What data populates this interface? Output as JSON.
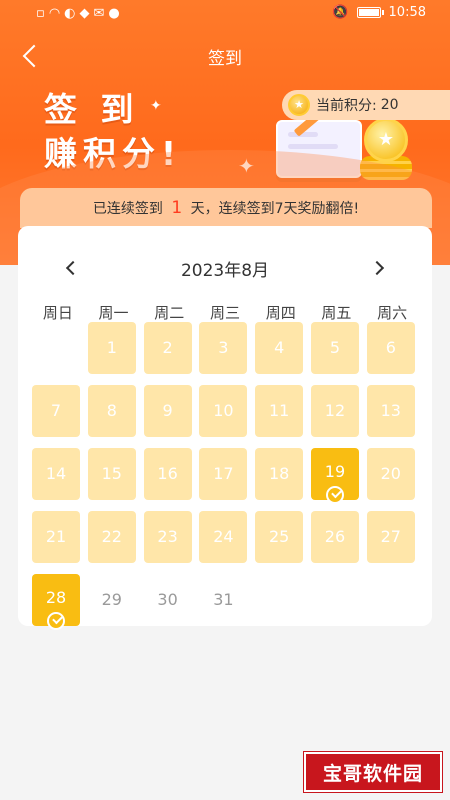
{
  "statusbar": {
    "time": "10:58",
    "icons": [
      "sim-icon",
      "wifi-icon",
      "data-icon",
      "signal-icon",
      "mail-icon",
      "app-icon",
      "mute-icon",
      "battery-icon"
    ]
  },
  "header": {
    "title": "签到",
    "slogan_line1": "签 到",
    "slogan_line2": "赚积分!",
    "points_label": "当前积分:",
    "points_value": "20"
  },
  "streak": {
    "prefix": "已连续签到",
    "days": "1",
    "suffix": "天，连续签到7天奖励翻倍!"
  },
  "calendar": {
    "month_label": "2023年8月",
    "weekdays": [
      "周日",
      "周一",
      "周二",
      "周三",
      "周四",
      "周五",
      "周六"
    ],
    "days": [
      {
        "label": "",
        "state": "empty"
      },
      {
        "label": "1",
        "state": "past"
      },
      {
        "label": "2",
        "state": "past"
      },
      {
        "label": "3",
        "state": "past"
      },
      {
        "label": "4",
        "state": "past"
      },
      {
        "label": "5",
        "state": "past"
      },
      {
        "label": "6",
        "state": "past"
      },
      {
        "label": "7",
        "state": "past"
      },
      {
        "label": "8",
        "state": "past"
      },
      {
        "label": "9",
        "state": "past"
      },
      {
        "label": "10",
        "state": "past"
      },
      {
        "label": "11",
        "state": "past"
      },
      {
        "label": "12",
        "state": "past"
      },
      {
        "label": "13",
        "state": "past"
      },
      {
        "label": "14",
        "state": "past"
      },
      {
        "label": "15",
        "state": "past"
      },
      {
        "label": "16",
        "state": "past"
      },
      {
        "label": "17",
        "state": "past"
      },
      {
        "label": "18",
        "state": "past"
      },
      {
        "label": "19",
        "state": "signed"
      },
      {
        "label": "20",
        "state": "past"
      },
      {
        "label": "21",
        "state": "past"
      },
      {
        "label": "22",
        "state": "past"
      },
      {
        "label": "23",
        "state": "past"
      },
      {
        "label": "24",
        "state": "past"
      },
      {
        "label": "25",
        "state": "past"
      },
      {
        "label": "26",
        "state": "past"
      },
      {
        "label": "27",
        "state": "past"
      },
      {
        "label": "28",
        "state": "signed"
      },
      {
        "label": "29",
        "state": "future"
      },
      {
        "label": "30",
        "state": "future"
      },
      {
        "label": "31",
        "state": "future"
      }
    ]
  },
  "watermark": "宝哥软件园",
  "colors": {
    "brand_orange": "#ff6a1c",
    "signed_gold": "#f9bd12",
    "past_cell": "#ffe6a9",
    "streak_red": "#ff3b1f",
    "watermark_red": "#c8161d"
  }
}
